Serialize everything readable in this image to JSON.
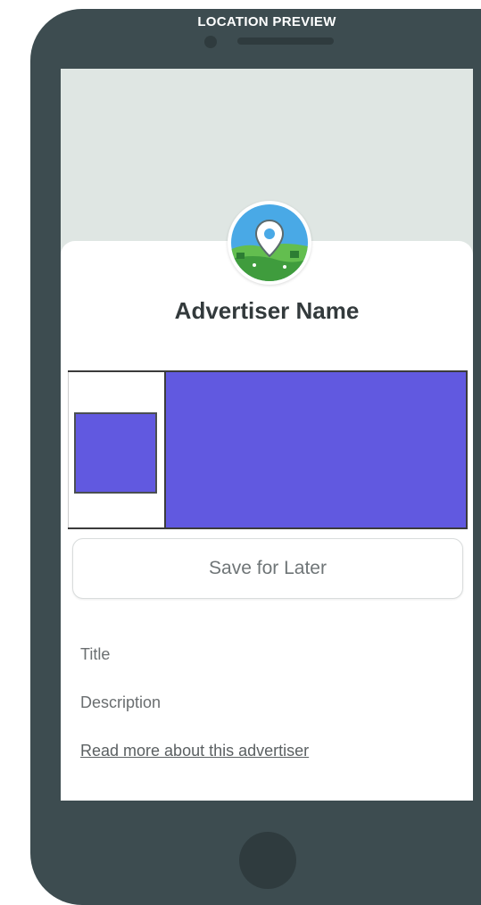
{
  "header": {
    "title": "LOCATION PREVIEW"
  },
  "card": {
    "advertiser_name": "Advertiser Name",
    "avatar_icon": "map-pin-landscape-icon",
    "save_label": "Save for Later",
    "title_label": "Title",
    "description_label": "Description",
    "read_more_label": "Read more about this advertiser"
  },
  "colors": {
    "phone_body": "#3d4c50",
    "screen_background": "#dfe6e3",
    "image_placeholder": "#6159e0"
  }
}
